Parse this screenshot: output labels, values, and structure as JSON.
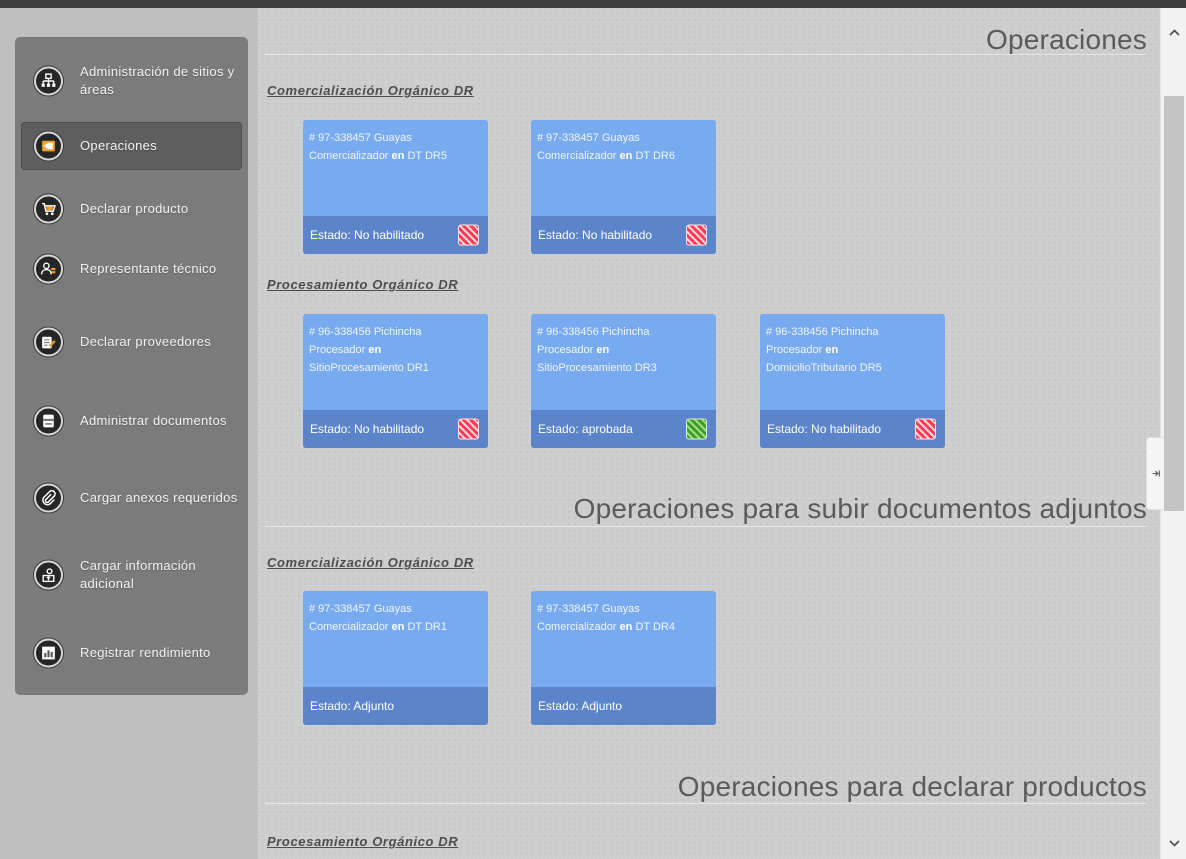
{
  "sidebar": {
    "items": [
      {
        "label": "Administración de sitios y áreas",
        "icon": "sitemap-icon"
      },
      {
        "label": "Operaciones",
        "icon": "operations-icon",
        "active": true
      },
      {
        "label": "Declarar producto",
        "icon": "cart-icon"
      },
      {
        "label": "Representante técnico",
        "icon": "users-icon"
      },
      {
        "label": "Declarar proveedores",
        "icon": "supplier-icon"
      },
      {
        "label": "Administrar documentos",
        "icon": "documents-icon"
      },
      {
        "label": "Cargar anexos requeridos",
        "icon": "paperclip-icon"
      },
      {
        "label": "Cargar información adicional",
        "icon": "upload-info-icon"
      },
      {
        "label": "Registrar rendimiento",
        "icon": "chart-icon"
      }
    ]
  },
  "sections": [
    {
      "title": "Operaciones",
      "groups": [
        {
          "title": "Comercialización Orgánico DR",
          "cards": [
            {
              "line1": "# 97-338457 Guayas",
              "role": "Comercializador",
              "connector": "en",
              "site": "DT DR5",
              "status": "Estado: No habilitado",
              "flag": "red"
            },
            {
              "line1": "# 97-338457 Guayas",
              "role": "Comercializador",
              "connector": "en",
              "site": "DT DR6",
              "status": "Estado: No habilitado",
              "flag": "red"
            }
          ]
        },
        {
          "title": "Procesamiento Orgánico DR",
          "cards": [
            {
              "line1": "# 96-338456 Pichincha",
              "role": "Procesador",
              "connector": "en",
              "site": "SitioProcesamiento DR1",
              "status": "Estado: No habilitado",
              "flag": "red"
            },
            {
              "line1": "# 96-338456 Pichincha",
              "role": "Procesador",
              "connector": "en",
              "site": "SitioProcesamiento DR3",
              "status": "Estado: aprobada",
              "flag": "green"
            },
            {
              "line1": "# 96-338456 Pichincha",
              "role": "Procesador",
              "connector": "en",
              "site": "DomicilioTributario DR5",
              "status": "Estado: No habilitado",
              "flag": "red"
            }
          ]
        }
      ]
    },
    {
      "title": "Operaciones para subir documentos adjuntos",
      "groups": [
        {
          "title": "Comercialización Orgánico DR",
          "cards": [
            {
              "line1": "# 97-338457 Guayas",
              "role": "Comercializador",
              "connector": "en",
              "site": "DT DR1",
              "status": "Estado: Adjunto",
              "flag": "none"
            },
            {
              "line1": "# 97-338457 Guayas",
              "role": "Comercializador",
              "connector": "en",
              "site": "DT DR4",
              "status": "Estado: Adjunto",
              "flag": "none"
            }
          ]
        }
      ]
    },
    {
      "title": "Operaciones para declarar productos",
      "groups": [
        {
          "title": "Procesamiento Orgánico DR",
          "cards": []
        }
      ]
    }
  ],
  "scrollbar": {
    "up_icon": "chevron-up-icon",
    "down_icon": "chevron-down-icon"
  },
  "side_tab": {
    "icon": "collapse-arrow-icon"
  },
  "colors": {
    "card_bg": "#77aaef",
    "card_footer": "#5b84cb",
    "status_red": "#ff3a52",
    "status_green": "#3e9a2c",
    "sidebar_bg": "#7b7b7b"
  }
}
